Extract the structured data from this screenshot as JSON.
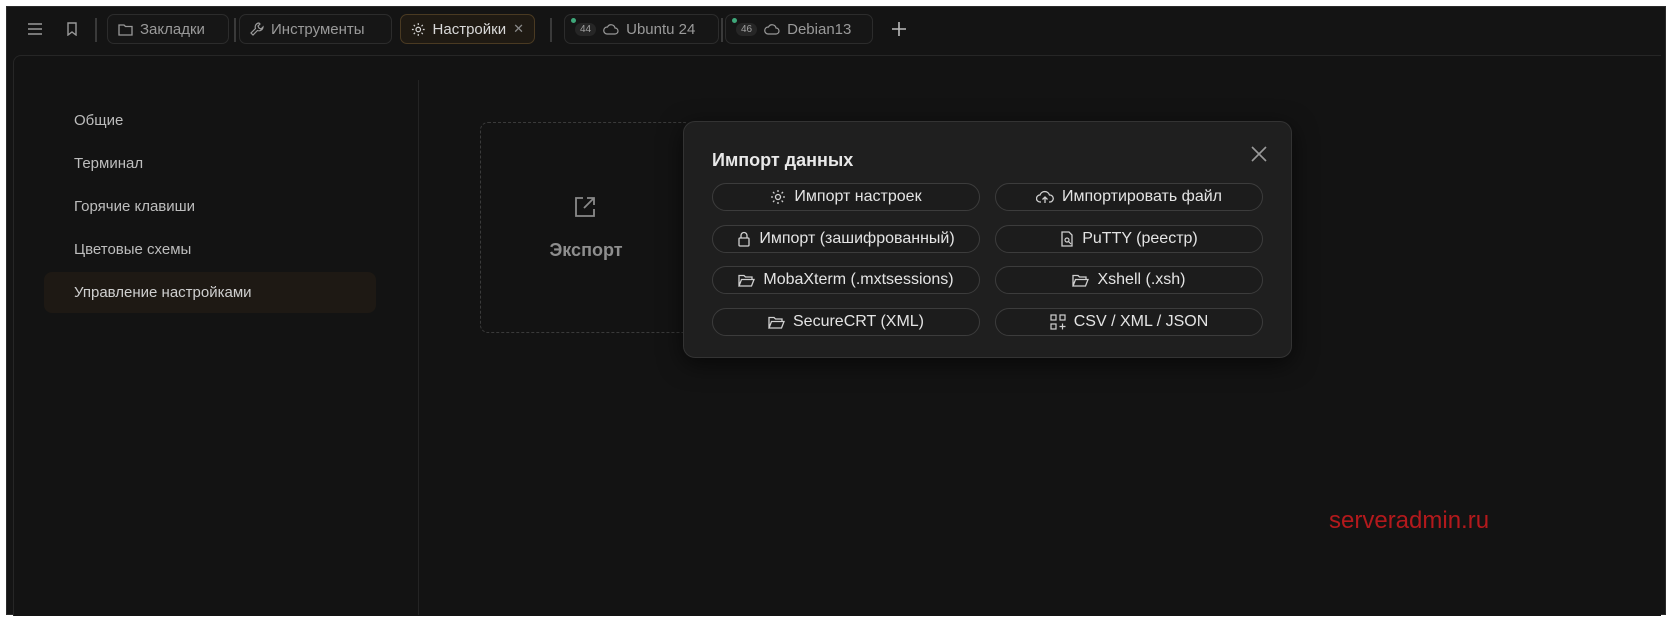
{
  "tabs": [
    {
      "label": "Закладки",
      "icon": "folder-icon"
    },
    {
      "label": "Инструменты",
      "icon": "wrench-icon"
    },
    {
      "label": "Настройки",
      "icon": "gear-icon",
      "active": true
    },
    {
      "label": "Ubuntu 24",
      "icon": "cloud-icon",
      "badge": "44"
    },
    {
      "label": "Debian13",
      "icon": "cloud-icon",
      "badge": "46"
    }
  ],
  "sidebar": {
    "items": [
      {
        "label": "Общие"
      },
      {
        "label": "Терминал"
      },
      {
        "label": "Горячие клавиши"
      },
      {
        "label": "Цветовые схемы"
      },
      {
        "label": "Управление настройками",
        "active": true
      }
    ]
  },
  "export_card": {
    "label": "Экспорт"
  },
  "modal": {
    "title": "Импорт данных",
    "buttons": [
      {
        "label": "Импорт настроек",
        "icon": "gear-icon"
      },
      {
        "label": "Импортировать файл",
        "icon": "cloud-upload-icon"
      },
      {
        "label": "Импорт (зашифрованный)",
        "icon": "lock-icon"
      },
      {
        "label": "PuTTY (реестр)",
        "icon": "document-search-icon"
      },
      {
        "label": "MobaXterm (.mxtsessions)",
        "icon": "folder-open-icon"
      },
      {
        "label": "Xshell (.xsh)",
        "icon": "folder-open-icon"
      },
      {
        "label": "SecureCRT (XML)",
        "icon": "folder-open-icon"
      },
      {
        "label": "CSV / XML / JSON",
        "icon": "grid-plus-icon"
      }
    ]
  },
  "watermark": "serveradmin.ru",
  "colors": {
    "accent_active": "#1e1914",
    "status_dot": "#3ea87a",
    "watermark": "#b3191c"
  }
}
